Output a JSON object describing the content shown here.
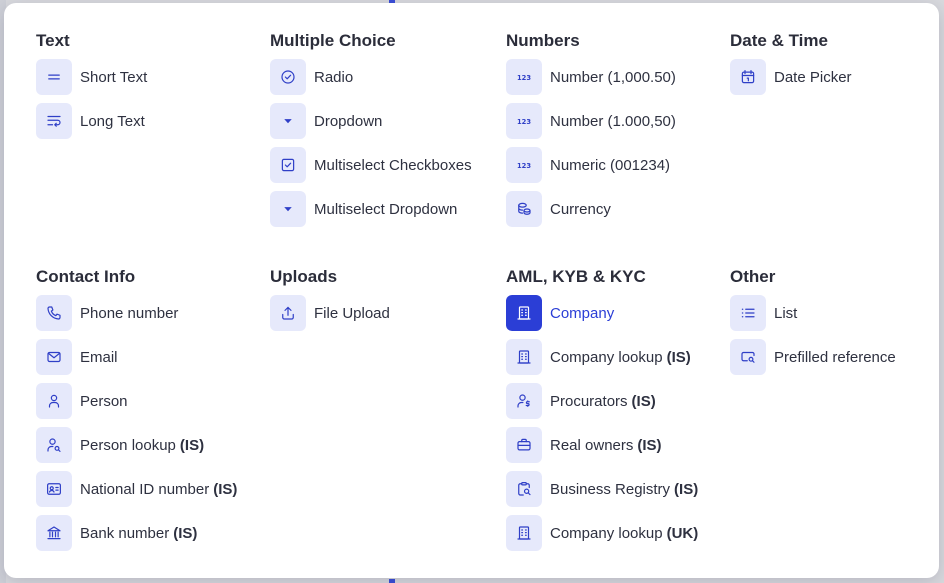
{
  "sections": [
    {
      "title": "Text",
      "items": [
        {
          "label": "Short Text",
          "icon": "short-text-icon"
        },
        {
          "label": "Long Text",
          "icon": "long-text-icon"
        }
      ]
    },
    {
      "title": "Multiple Choice",
      "items": [
        {
          "label": "Radio",
          "icon": "radio-icon"
        },
        {
          "label": "Dropdown",
          "icon": "dropdown-icon"
        },
        {
          "label": "Multiselect Checkboxes",
          "icon": "checkbox-icon"
        },
        {
          "label": "Multiselect Dropdown",
          "icon": "dropdown-icon"
        }
      ]
    },
    {
      "title": "Numbers",
      "items": [
        {
          "label": "Number (1,000.50)",
          "icon": "number-icon"
        },
        {
          "label": "Number (1.000,50)",
          "icon": "number-icon"
        },
        {
          "label": "Numeric (001234)",
          "icon": "number-icon"
        },
        {
          "label": "Currency",
          "icon": "currency-icon"
        }
      ]
    },
    {
      "title": "Date & Time",
      "items": [
        {
          "label": "Date Picker",
          "icon": "calendar-icon"
        }
      ]
    },
    {
      "title": "Contact Info",
      "items": [
        {
          "label": "Phone number",
          "icon": "phone-icon"
        },
        {
          "label": "Email",
          "icon": "email-icon"
        },
        {
          "label": "Person",
          "icon": "person-icon"
        },
        {
          "label": "Person lookup",
          "suffix": "(IS)",
          "icon": "person-search-icon"
        },
        {
          "label": "National ID number",
          "suffix": "(IS)",
          "icon": "id-card-icon"
        },
        {
          "label": "Bank number",
          "suffix": "(IS)",
          "icon": "bank-icon"
        }
      ]
    },
    {
      "title": "Uploads",
      "items": [
        {
          "label": "File Upload",
          "icon": "upload-icon"
        }
      ]
    },
    {
      "title": "AML, KYB & KYC",
      "items": [
        {
          "label": "Company",
          "icon": "building-icon",
          "active": true
        },
        {
          "label": "Company lookup",
          "suffix": "(IS)",
          "icon": "building-icon"
        },
        {
          "label": "Procurators",
          "suffix": "(IS)",
          "icon": "person-dollar-icon"
        },
        {
          "label": "Real owners",
          "suffix": "(IS)",
          "icon": "briefcase-icon"
        },
        {
          "label": "Business Registry",
          "suffix": "(IS)",
          "icon": "clipboard-search-icon"
        },
        {
          "label": "Company lookup",
          "suffix": "(UK)",
          "icon": "building-icon"
        }
      ]
    },
    {
      "title": "Other",
      "items": [
        {
          "label": "List",
          "icon": "list-icon"
        },
        {
          "label": "Prefilled reference",
          "icon": "prefilled-reference-icon"
        }
      ]
    }
  ],
  "colors": {
    "accent": "#2b3ed6",
    "icon_bg": "#e6e9fb",
    "icon_fg": "#2f3fc7",
    "text": "#2e3140"
  }
}
